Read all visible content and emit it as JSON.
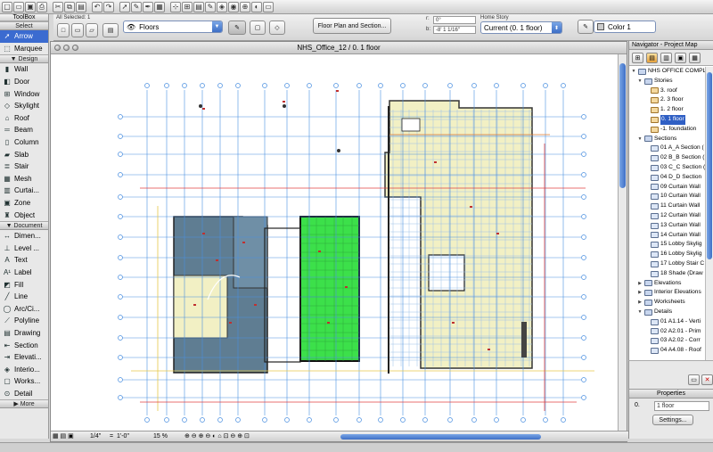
{
  "toolbar": {
    "icons": [
      "new-icon",
      "open-icon",
      "save-icon",
      "print-icon",
      "cut-icon",
      "copy-icon",
      "paste-icon",
      "undo-icon",
      "redo-icon",
      "pointer-icon",
      "eyedropper-icon",
      "syringe-icon",
      "grid-icon",
      "snap-icon",
      "guide-icon",
      "layer-icon",
      "pen-icon",
      "3d-icon",
      "camera-icon",
      "zoom-icon",
      "render-icon",
      "window-icon"
    ]
  },
  "toolbox": {
    "title": "ToolBox",
    "select_header": "Select",
    "select_tools": [
      {
        "label": "Arrow",
        "icon": "arrow-icon",
        "glyph": "➚",
        "active": true
      },
      {
        "label": "Marquee",
        "icon": "marquee-icon",
        "glyph": "⬚",
        "active": false
      }
    ],
    "design_header": "Design",
    "design_tools": [
      {
        "label": "Wall",
        "icon": "wall-icon",
        "glyph": "▮"
      },
      {
        "label": "Door",
        "icon": "door-icon",
        "glyph": "◧"
      },
      {
        "label": "Window",
        "icon": "window-tool-icon",
        "glyph": "⊞"
      },
      {
        "label": "Skylight",
        "icon": "skylight-icon",
        "glyph": "◇"
      },
      {
        "label": "Roof",
        "icon": "roof-icon",
        "glyph": "⌂"
      },
      {
        "label": "Beam",
        "icon": "beam-icon",
        "glyph": "═"
      },
      {
        "label": "Column",
        "icon": "column-icon",
        "glyph": "▯"
      },
      {
        "label": "Slab",
        "icon": "slab-icon",
        "glyph": "▰"
      },
      {
        "label": "Stair",
        "icon": "stair-icon",
        "glyph": "≣"
      },
      {
        "label": "Mesh",
        "icon": "mesh-icon",
        "glyph": "▦"
      },
      {
        "label": "Curtai...",
        "icon": "curtain-wall-icon",
        "glyph": "▥"
      },
      {
        "label": "Zone",
        "icon": "zone-icon",
        "glyph": "▣"
      },
      {
        "label": "Object",
        "icon": "object-icon",
        "glyph": "♜"
      }
    ],
    "document_header": "Document",
    "document_tools": [
      {
        "label": "Dimen...",
        "icon": "dimension-icon",
        "glyph": "↔"
      },
      {
        "label": "Level ...",
        "icon": "level-icon",
        "glyph": "⊥"
      },
      {
        "label": "Text",
        "icon": "text-icon",
        "glyph": "A"
      },
      {
        "label": "Label",
        "icon": "label-icon",
        "glyph": "A¹"
      },
      {
        "label": "Fill",
        "icon": "fill-icon",
        "glyph": "◩"
      },
      {
        "label": "Line",
        "icon": "line-icon",
        "glyph": "╱"
      },
      {
        "label": "Arc/Ci...",
        "icon": "arc-icon",
        "glyph": "◯"
      },
      {
        "label": "Polyline",
        "icon": "polyline-icon",
        "glyph": "⟋"
      },
      {
        "label": "Drawing",
        "icon": "drawing-icon",
        "glyph": "▤"
      },
      {
        "label": "Section",
        "icon": "section-icon",
        "glyph": "⇤"
      },
      {
        "label": "Elevati...",
        "icon": "elevation-icon",
        "glyph": "⇥"
      },
      {
        "label": "Interio...",
        "icon": "interior-elevation-icon",
        "glyph": "◈"
      },
      {
        "label": "Works...",
        "icon": "worksheet-icon",
        "glyph": "▢"
      },
      {
        "label": "Detail",
        "icon": "detail-icon",
        "glyph": "⊙"
      }
    ],
    "more_header": "More"
  },
  "infobox": {
    "selected_label": "All Selected: 1",
    "floors_label": "Floors",
    "floor_plan_button": "Floor Plan and Section...",
    "angle_value": "0°",
    "offset_label": "b:",
    "offset_value": "-8' 1 1/16\"",
    "home_story_label": "Home Story",
    "home_story_value": "Current (0. 1 floor)",
    "color_label": "Color 1"
  },
  "drawing": {
    "window_title": "NHS_Office_12 / 0. 1 floor",
    "scale": "1/4\"",
    "scale_value": "1'-0\"",
    "zoom": "15 %"
  },
  "navigator": {
    "title": "Navigator - Project Map",
    "tree": [
      {
        "label": "NHS OFFICE COMPLEX",
        "level": 0,
        "kind": "folder",
        "open": true,
        "selected": false
      },
      {
        "label": "Stories",
        "level": 1,
        "kind": "folder",
        "open": true,
        "selected": false
      },
      {
        "label": "3. roof",
        "level": 2,
        "kind": "story",
        "selected": false
      },
      {
        "label": "2. 3 floor",
        "level": 2,
        "kind": "story",
        "selected": false
      },
      {
        "label": "1. 2 floor",
        "level": 2,
        "kind": "story",
        "selected": false
      },
      {
        "label": "0. 1 floor",
        "level": 2,
        "kind": "story",
        "selected": true
      },
      {
        "label": "-1. foundation",
        "level": 2,
        "kind": "story",
        "selected": false
      },
      {
        "label": "Sections",
        "level": 1,
        "kind": "folder",
        "open": true,
        "selected": false
      },
      {
        "label": "01 A_A Section (",
        "level": 2,
        "kind": "view",
        "selected": false
      },
      {
        "label": "02 B_B Section (",
        "level": 2,
        "kind": "view",
        "selected": false
      },
      {
        "label": "03 C_C Section (",
        "level": 2,
        "kind": "view",
        "selected": false
      },
      {
        "label": "04 D_D Section",
        "level": 2,
        "kind": "view",
        "selected": false
      },
      {
        "label": "09 Curtain Wall",
        "level": 2,
        "kind": "view",
        "selected": false
      },
      {
        "label": "10 Curtain Wall",
        "level": 2,
        "kind": "view",
        "selected": false
      },
      {
        "label": "11 Curtain Wall",
        "level": 2,
        "kind": "view",
        "selected": false
      },
      {
        "label": "12 Curtain Wall",
        "level": 2,
        "kind": "view",
        "selected": false
      },
      {
        "label": "13 Curtain Wall",
        "level": 2,
        "kind": "view",
        "selected": false
      },
      {
        "label": "14 Curtain Wall",
        "level": 2,
        "kind": "view",
        "selected": false
      },
      {
        "label": "15 Lobby Skylig",
        "level": 2,
        "kind": "view",
        "selected": false
      },
      {
        "label": "16 Lobby Skylig",
        "level": 2,
        "kind": "view",
        "selected": false
      },
      {
        "label": "17 Lobby Stair C",
        "level": 2,
        "kind": "view",
        "selected": false
      },
      {
        "label": "18 Shade (Draw",
        "level": 2,
        "kind": "view",
        "selected": false
      },
      {
        "label": "Elevations",
        "level": 1,
        "kind": "folder",
        "open": false,
        "selected": false
      },
      {
        "label": "Interior Elevations",
        "level": 1,
        "kind": "folder",
        "open": false,
        "selected": false
      },
      {
        "label": "Worksheets",
        "level": 1,
        "kind": "folder",
        "open": false,
        "selected": false
      },
      {
        "label": "Details",
        "level": 1,
        "kind": "folder",
        "open": true,
        "selected": false
      },
      {
        "label": "01 A1.14 - Verti",
        "level": 2,
        "kind": "view",
        "selected": false
      },
      {
        "label": "02 A2.01 - Prim",
        "level": 2,
        "kind": "view",
        "selected": false
      },
      {
        "label": "03 A2.02 - Corr",
        "level": 2,
        "kind": "view",
        "selected": false
      },
      {
        "label": "04 A4.08 - Roof",
        "level": 2,
        "kind": "view",
        "selected": false
      }
    ]
  },
  "properties": {
    "title": "Properties",
    "index": "0.",
    "value": "1 floor",
    "settings_button": "Settings..."
  },
  "colors": {
    "selection_blue": "#3b6bd0",
    "grid_blue": "#4a8fe0",
    "slab_green": "#3ce04a",
    "building_gray_blue": "#5f7d92",
    "building_yellow": "#f2f0c4",
    "wall_red": "#e04040"
  }
}
